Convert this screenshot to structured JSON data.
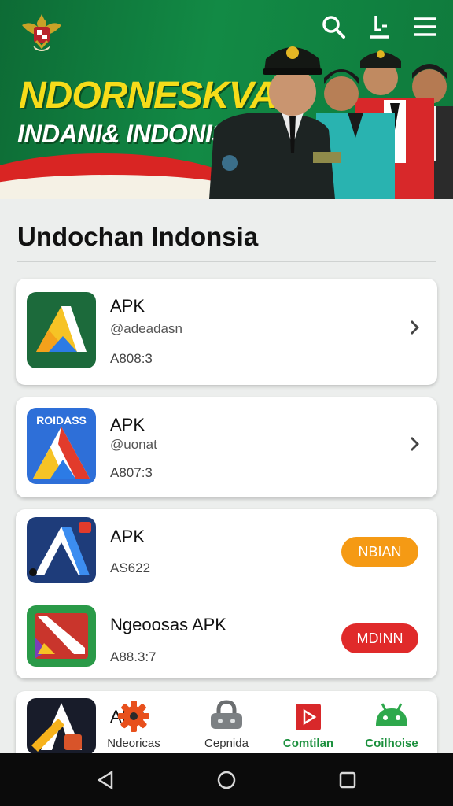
{
  "banner": {
    "title": "NDORNESKVA",
    "subtitle": "INDANI& INDONISIA",
    "icons": [
      "emblem-icon",
      "search-icon",
      "download-icon",
      "menu-icon"
    ]
  },
  "section_title": "Undochan Indonsia",
  "apps": [
    {
      "title": "APK",
      "subtitle": "@adeadasn",
      "version": "A808:3",
      "icon_text": ""
    },
    {
      "title": "APK",
      "subtitle": "@uonat",
      "version": "A807:3",
      "icon_text": "ROIDASS"
    },
    {
      "title": "APK",
      "subtitle": "",
      "version": "AS622",
      "button": "NBIAN"
    },
    {
      "title": "Ngeoosas APK",
      "subtitle": "",
      "version": "A88.3:7",
      "button": "MDINN"
    },
    {
      "title": "APP",
      "subtitle": "",
      "version": ""
    }
  ],
  "tabs": [
    {
      "label": "Ndeoricas",
      "icon": "gear-icon"
    },
    {
      "label": "Cepnida",
      "icon": "lock-icon"
    },
    {
      "label": "Comtilan",
      "icon": "play-icon"
    },
    {
      "label": "Coilhoise",
      "icon": "android-icon"
    }
  ],
  "colors": {
    "banner_green": "#0f7a3c",
    "title_yellow": "#f6dc1a",
    "orange_button": "#f59a14",
    "red_button": "#e02a2a",
    "tab_green": "#1a8f3c"
  }
}
